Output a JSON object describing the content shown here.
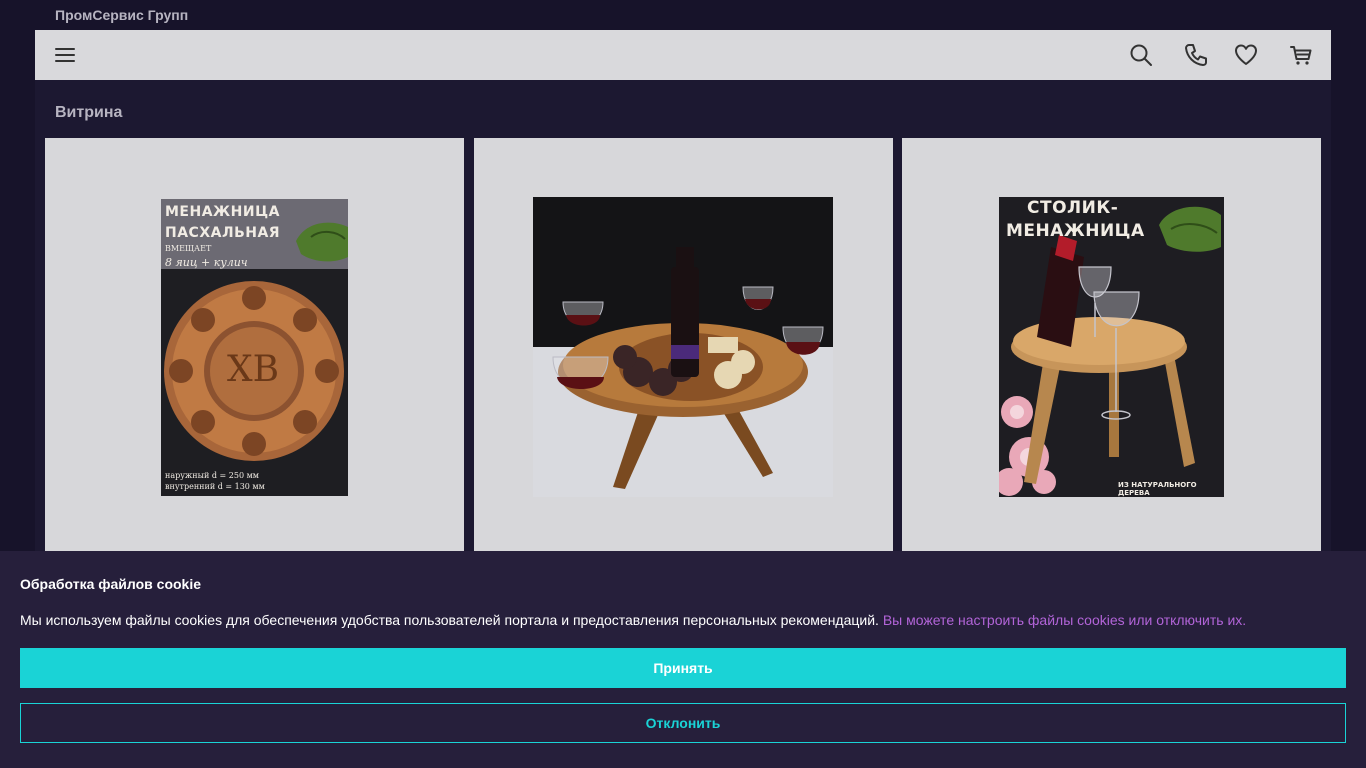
{
  "header": {
    "company_name": "ПромСервис Групп"
  },
  "navbar": {
    "icons": [
      "menu-icon",
      "search-icon",
      "phone-icon",
      "heart-icon",
      "cart-icon"
    ]
  },
  "section": {
    "title": "Витрина"
  },
  "products": [
    {
      "image": "menazhnitsa-easter-image",
      "poster_line1": "МЕНАЖНИЦА",
      "poster_line2": "ПАСХАЛЬНАЯ",
      "poster_line3": "ВМЕЩАЕТ",
      "poster_line4": "8 яиц + кулич",
      "poster_center": "ХВ",
      "poster_dim1": "наружный d = 250 мм",
      "poster_dim2": "внутренний d = 130 мм"
    },
    {
      "image": "wine-table-snacks-image"
    },
    {
      "image": "stolik-menazhnitsa-image",
      "poster_line1": "СТОЛИК-",
      "poster_line2": "МЕНАЖНИЦА",
      "poster_footer": "ИЗ НАТУРАЛЬНОГО ДЕРЕВА"
    }
  ],
  "cookie": {
    "title": "Обработка файлов cookie",
    "text": "Мы используем файлы cookies для обеспечения удобства пользователей портала и предоставления персональных рекомендаций.",
    "link": "Вы можете настроить файлы cookies или отключить их.",
    "accept_label": "Принять",
    "reject_label": "Отклонить"
  },
  "colors": {
    "accent": "#1ad3d6",
    "link": "#b264d8",
    "banner_bg": "#261f3b"
  }
}
